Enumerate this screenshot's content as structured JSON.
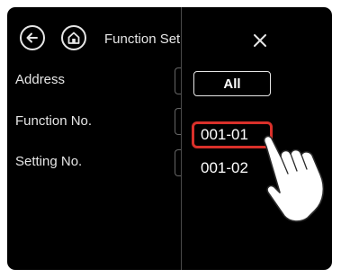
{
  "header": {
    "title": "Function Setting"
  },
  "fields": [
    {
      "label": "Address"
    },
    {
      "label": "Function No."
    },
    {
      "label": "Setting No."
    }
  ],
  "filter": {
    "all_label": "All"
  },
  "list": {
    "items": [
      "001-01",
      "001-02"
    ],
    "selected_index": 0
  },
  "colors": {
    "background": "#000000",
    "text": "#e6e6e6",
    "highlight": "#d9302a"
  }
}
